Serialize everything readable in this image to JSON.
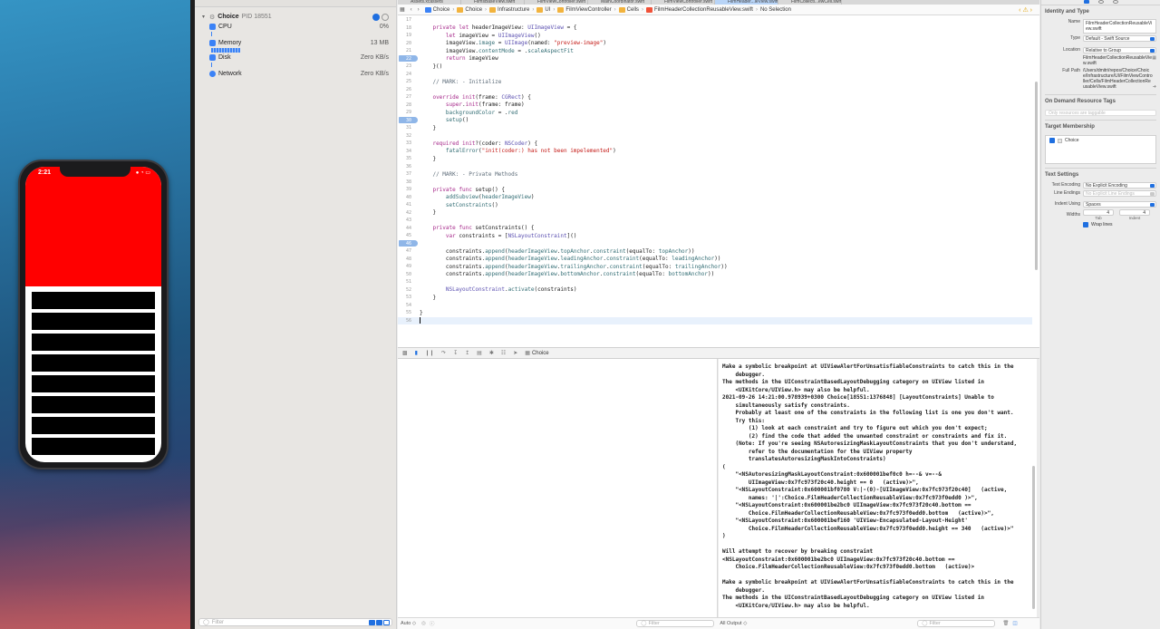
{
  "simulator": {
    "status_time": "2:21",
    "status_icons": "● ◔ ▭",
    "rows": 8,
    "header_color": "#ff0000"
  },
  "navigator": {
    "process": {
      "name": "Choice",
      "pid": "PID 18551"
    },
    "gauges": [
      {
        "label": "CPU",
        "value": "0%"
      },
      {
        "label": "Memory",
        "value": "13 MB"
      },
      {
        "label": "Disk",
        "value": "Zero KB/s"
      },
      {
        "label": "Network",
        "value": "Zero KB/s"
      }
    ],
    "filter_placeholder": "Filter"
  },
  "tabs": [
    "Assets.xcassets",
    "FilmsBaseView.swift",
    "FilmViewController.swift",
    "MainCoordinator.swift",
    "FilmViewController.swift",
    "FilmHeader...leView.swift",
    "FilmCollecti...ewCell.swift"
  ],
  "jumpbar": {
    "crumbs": [
      "Choice",
      "Choice",
      "Infrastructure",
      "UI",
      "FilmViewController",
      "Cells",
      "FilmHeaderCollectionReusableView.swift",
      "No Selection"
    ]
  },
  "code_lines": [
    {
      "n": "17",
      "html": ""
    },
    {
      "n": "18",
      "html": "    <span class='kw'>private let</span> headerImageView: <span class='ty'>UIImageView</span> = {"
    },
    {
      "n": "19",
      "html": "        <span class='kw'>let</span> imageView = <span class='ty'>UIImageView</span>()"
    },
    {
      "n": "20",
      "html": "        imageView.<span class='fn'>image</span> = <span class='ty'>UIImage</span>(named: <span class='str'>\"preview-image\"</span>)"
    },
    {
      "n": "21",
      "html": "        imageView.<span class='fn'>contentMode</span> = .<span class='fn'>scaleAspectFit</span>"
    },
    {
      "n": "22",
      "html": "        <span class='kw'>return</span> imageView",
      "bp": true
    },
    {
      "n": "23",
      "html": "    }()"
    },
    {
      "n": "24",
      "html": ""
    },
    {
      "n": "25",
      "html": "    <span class='cm'>// MARK: - Initialize</span>"
    },
    {
      "n": "26",
      "html": ""
    },
    {
      "n": "27",
      "html": "    <span class='kw'>override init</span>(frame: <span class='ty'>CGRect</span>) {"
    },
    {
      "n": "28",
      "html": "        <span class='kw'>super</span>.<span class='kw'>init</span>(frame: frame)"
    },
    {
      "n": "29",
      "html": "        <span class='fn'>backgroundColor</span> = .<span class='fn'>red</span>"
    },
    {
      "n": "30",
      "html": "        <span class='fn'>setup</span>()",
      "bp": true
    },
    {
      "n": "31",
      "html": "    }"
    },
    {
      "n": "32",
      "html": ""
    },
    {
      "n": "33",
      "html": "    <span class='kw'>required init</span>?(coder: <span class='ty'>NSCoder</span>) {"
    },
    {
      "n": "34",
      "html": "        <span class='fn'>fatalError</span>(<span class='str'>\"init(coder:) has not been impelemented\"</span>)"
    },
    {
      "n": "35",
      "html": "    }"
    },
    {
      "n": "36",
      "html": ""
    },
    {
      "n": "37",
      "html": "    <span class='cm'>// MARK: - Private Methods</span>"
    },
    {
      "n": "38",
      "html": ""
    },
    {
      "n": "39",
      "html": "    <span class='kw'>private func</span> setup() {"
    },
    {
      "n": "40",
      "html": "        <span class='fn'>addSubview</span>(<span class='fn'>headerImageView</span>)"
    },
    {
      "n": "41",
      "html": "        <span class='fn'>setConstraints</span>()"
    },
    {
      "n": "42",
      "html": "    }"
    },
    {
      "n": "43",
      "html": ""
    },
    {
      "n": "44",
      "html": "    <span class='kw'>private func</span> setConstraints() {"
    },
    {
      "n": "45",
      "html": "        <span class='kw'>var</span> constraints = [<span class='ty'>NSLayoutConstraint</span>]()"
    },
    {
      "n": "46",
      "html": "",
      "bp": true
    },
    {
      "n": "47",
      "html": "        constraints.<span class='fn'>append</span>(<span class='fn'>headerImageView</span>.<span class='fn'>topAnchor</span>.<span class='fn'>constraint</span>(equalTo: <span class='fn'>topAnchor</span>))"
    },
    {
      "n": "48",
      "html": "        constraints.<span class='fn'>append</span>(<span class='fn'>headerImageView</span>.<span class='fn'>leadingAnchor</span>.<span class='fn'>constraint</span>(equalTo: <span class='fn'>leadingAnchor</span>))"
    },
    {
      "n": "49",
      "html": "        constraints.<span class='fn'>append</span>(<span class='fn'>headerImageView</span>.<span class='fn'>trailingAnchor</span>.<span class='fn'>constraint</span>(equalTo: <span class='fn'>trailingAnchor</span>))"
    },
    {
      "n": "50",
      "html": "        constraints.<span class='fn'>append</span>(<span class='fn'>headerImageView</span>.<span class='fn'>bottomAnchor</span>.<span class='fn'>constraint</span>(equalTo: <span class='fn'>bottomAnchor</span>))"
    },
    {
      "n": "51",
      "html": ""
    },
    {
      "n": "52",
      "html": "        <span class='ty'>NSLayoutConstraint</span>.<span class='fn'>activate</span>(constraints)"
    },
    {
      "n": "53",
      "html": "    }"
    },
    {
      "n": "54",
      "html": ""
    },
    {
      "n": "55",
      "html": "}"
    },
    {
      "n": "56",
      "html": "",
      "cur": true
    }
  ],
  "debug_bar": {
    "target": "Choice"
  },
  "console_text": "Make a symbolic breakpoint at UIViewAlertForUnsatisfiableConstraints to catch this in the\n    debugger.\nThe methods in the UIConstraintBasedLayoutDebugging category on UIView listed in\n    <UIKitCore/UIView.h> may also be helpful.\n2021-09-26 14:21:00.978939+0300 Choice[18551:1376848] [LayoutConstraints] Unable to\n    simultaneously satisfy constraints.\n    Probably at least one of the constraints in the following list is one you don't want.\n    Try this:\n        (1) look at each constraint and try to figure out which you don't expect;\n        (2) find the code that added the unwanted constraint or constraints and fix it.\n    (Note: If you're seeing NSAutoresizingMaskLayoutConstraints that you don't understand,\n        refer to the documentation for the UIView property\n        translatesAutoresizingMaskIntoConstraints)\n(\n    \"<NSAutoresizingMaskLayoutConstraint:0x600001bef0c0 h=--& v=--&\n        UIImageView:0x7fc973f20c40.height == 0   (active)>\",\n    \"<NSLayoutConstraint:0x600001bf0780 V:|-(0)-[UIImageView:0x7fc973f20c40]   (active,\n        names: '|':Choice.FilmHeaderCollectionReusableView:0x7fc973f0edd0 )>\",\n    \"<NSLayoutConstraint:0x600001be2bc0 UIImageView:0x7fc973f20c40.bottom ==\n        Choice.FilmHeaderCollectionReusableView:0x7fc973f0edd0.bottom   (active)>\",\n    \"<NSLayoutConstraint:0x600001bef160 'UIView-Encapsulated-Layout-Height'\n        Choice.FilmHeaderCollectionReusableView:0x7fc973f0edd0.height == 340   (active)>\"\n)\n\nWill attempt to recover by breaking constraint\n<NSLayoutConstraint:0x600001be2bc0 UIImageView:0x7fc973f20c40.bottom ==\n    Choice.FilmHeaderCollectionReusableView:0x7fc973f0edd0.bottom   (active)>\n\nMake a symbolic breakpoint at UIViewAlertForUnsatisfiableConstraints to catch this in the\n    debugger.\nThe methods in the UIConstraintBasedLayoutDebugging category on UIView listed in\n    <UIKitCore/UIView.h> may also be helpful.",
  "debug_bottom": {
    "auto_label": "Auto ◇",
    "filter1": "Filter",
    "output_label": "All Output ◇",
    "filter2": "Filter"
  },
  "inspector": {
    "identity_title": "Identity and Type",
    "name_label": "Name",
    "name_value": "FilmHeaderCollectionReusableView.swift",
    "type_label": "Type",
    "type_value": "Default - Swift Source",
    "location_label": "Location",
    "location_value": "Relative to Group",
    "location_path": "FilmHeaderCollectionReusableView.swift",
    "fullpath_label": "Full Path",
    "fullpath_value": "/Users/dmitri/repos/Choice/Choice/Infrastructure/UI/FilmViewController/Cells/FilmHeaderCollectionReusableView.swift",
    "odr_title": "On Demand Resource Tags",
    "odr_placeholder": "Only resources are taggable",
    "tm_title": "Target Membership",
    "tm_target": "Choice",
    "ts_title": "Text Settings",
    "encoding_label": "Text Encoding",
    "encoding_value": "No Explicit Encoding",
    "endings_label": "Line Endings",
    "endings_value": "No Explicit Line Endings",
    "indent_label": "Indent Using",
    "indent_value": "Spaces",
    "widths_label": "Widths",
    "tab_value": "4",
    "indent_width_value": "4",
    "tab_label": "Tab",
    "indent_sub_label": "Indent",
    "wrap_label": "Wrap lines"
  }
}
